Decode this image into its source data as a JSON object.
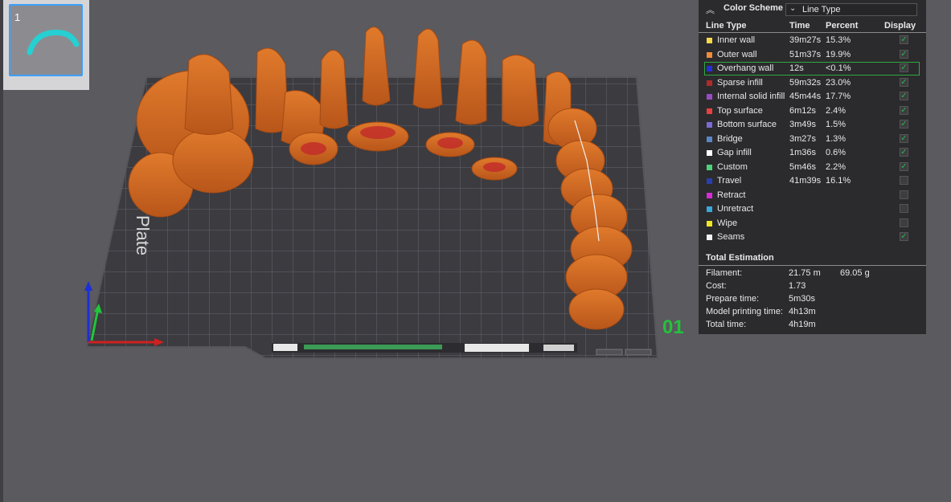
{
  "thumbnail": {
    "plate_number": "1"
  },
  "plate": {
    "label": "Plate",
    "marker": "01"
  },
  "legend": {
    "header_label": "Color Scheme",
    "scheme_select": "Line Type",
    "columns": {
      "line_type": "Line Type",
      "time": "Time",
      "percent": "Percent",
      "display": "Display"
    },
    "rows": [
      {
        "name": "Inner wall",
        "time": "39m27s",
        "percent": "15.3%",
        "color": "#f5d94a",
        "checked": true
      },
      {
        "name": "Outer wall",
        "time": "51m37s",
        "percent": "19.9%",
        "color": "#f08b3c",
        "checked": true
      },
      {
        "name": "Overhang wall",
        "time": "12s",
        "percent": "<0.1%",
        "color": "#2430d6",
        "checked": true
      },
      {
        "name": "Sparse infill",
        "time": "59m32s",
        "percent": "23.0%",
        "color": "#b02a2a",
        "checked": true
      },
      {
        "name": "Internal solid infill",
        "time": "45m44s",
        "percent": "17.7%",
        "color": "#9a4bc4",
        "checked": true
      },
      {
        "name": "Top surface",
        "time": "6m12s",
        "percent": "2.4%",
        "color": "#e84040",
        "checked": true
      },
      {
        "name": "Bottom surface",
        "time": "3m49s",
        "percent": "1.5%",
        "color": "#7a6ad4",
        "checked": true
      },
      {
        "name": "Bridge",
        "time": "3m27s",
        "percent": "1.3%",
        "color": "#5a86c8",
        "checked": true
      },
      {
        "name": "Gap infill",
        "time": "1m36s",
        "percent": "0.6%",
        "color": "#ffffff",
        "checked": true
      },
      {
        "name": "Custom",
        "time": "5m46s",
        "percent": "2.2%",
        "color": "#4ed37a",
        "checked": true
      },
      {
        "name": "Travel",
        "time": "41m39s",
        "percent": "16.1%",
        "color": "#2a3eb0",
        "checked": false
      },
      {
        "name": "Retract",
        "time": "",
        "percent": "",
        "color": "#d62cd4",
        "checked": false
      },
      {
        "name": "Unretract",
        "time": "",
        "percent": "",
        "color": "#3aa8d8",
        "checked": false
      },
      {
        "name": "Wipe",
        "time": "",
        "percent": "",
        "color": "#f0e824",
        "checked": false
      },
      {
        "name": "Seams",
        "time": "",
        "percent": "",
        "color": "#f2f2f2",
        "checked": true
      }
    ],
    "total_title": "Total Estimation",
    "estimation": {
      "filament_label": "Filament:",
      "filament_length": "21.75 m",
      "filament_weight": "69.05 g",
      "cost_label": "Cost:",
      "cost": "1.73",
      "prepare_label": "Prepare time:",
      "prepare": "5m30s",
      "model_label": "Model printing time:",
      "model": "4h13m",
      "total_label": "Total time:",
      "total": "4h19m"
    }
  },
  "icons": {
    "collapse": "double-chevron-up-icon",
    "dropdown": "chevron-down-icon",
    "check": "checkmark-icon"
  }
}
